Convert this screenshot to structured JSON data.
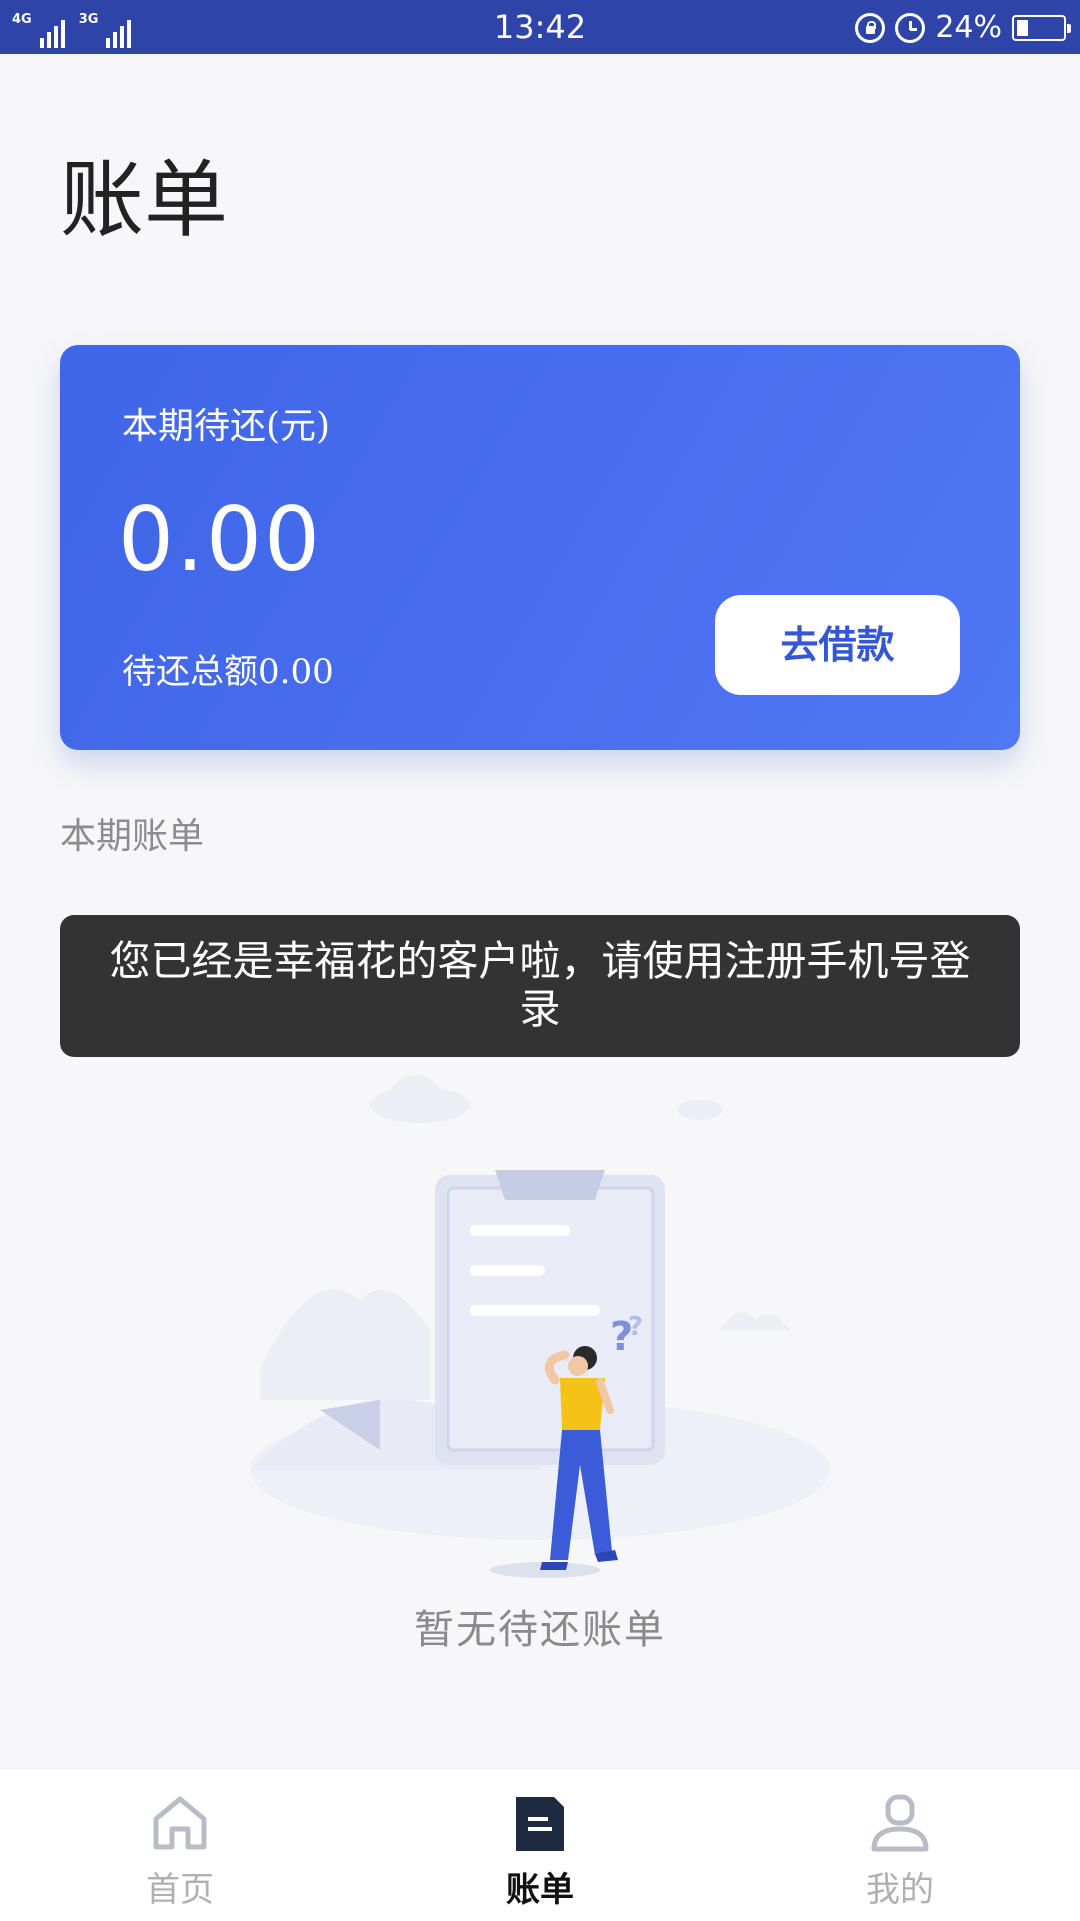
{
  "status_bar": {
    "network_1": "4G",
    "network_2": "3G",
    "time": "13:42",
    "battery_text": "24%",
    "battery_level": 0.24,
    "icons": [
      "signal-icon",
      "lock-rotation-icon",
      "alarm-icon",
      "battery-icon"
    ]
  },
  "page": {
    "title": "账单"
  },
  "card": {
    "label": "本期待还(元)",
    "amount": "0.00",
    "total_text": "待还总额0.00",
    "borrow_button": "去借款",
    "colors": {
      "start": "#3f65e8",
      "end": "#4f78f5"
    }
  },
  "section": {
    "title": "本期账单"
  },
  "toast": {
    "message": "您已经是幸福花的客户啦，请使用注册手机号登录"
  },
  "empty_state": {
    "text": "暂无待还账单",
    "illustration": "person-with-clipboard-illustration"
  },
  "tabs": [
    {
      "label": "首页",
      "icon": "home-icon",
      "active": false
    },
    {
      "label": "账单",
      "icon": "bill-icon",
      "active": true
    },
    {
      "label": "我的",
      "icon": "profile-icon",
      "active": false
    }
  ],
  "colors": {
    "status_bar": "#2e44a8",
    "accent": "#3557d6",
    "active_tab_icon": "#1e2a3f"
  }
}
